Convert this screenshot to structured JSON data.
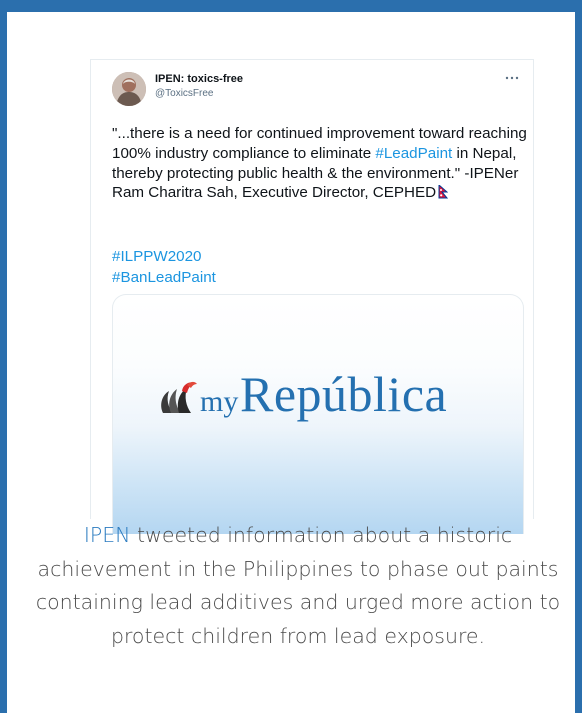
{
  "tweet": {
    "author_name": "IPEN: toxics-free",
    "author_handle": "@ToxicsFree",
    "text_before_hashtag": "\"...there is a need for continued improvement toward reaching 100% industry compliance to eliminate ",
    "inline_hashtag": "#LeadPaint",
    "text_after_hashtag": " in Nepal, thereby protecting public health & the environment.\" -IPENer Ram Charitra Sah, Executive Director, CEPHED",
    "hashtags": [
      "#ILPPW2020",
      "#BanLeadPaint"
    ],
    "link_preview": {
      "brand_prefix": "my",
      "brand_main": "República"
    }
  },
  "caption": {
    "link_text": "IPEN",
    "text": " tweeted information about a historic achievement in the Philippines to phase out paints containing lead additives and urged more action to protect children from lead exposure."
  },
  "colors": {
    "frame": "#2b6fad",
    "hashtag": "#1b95e0",
    "brand": "#2470b0",
    "caption_link": "#2b7bc0",
    "caption_text": "#4a4a4a"
  },
  "icons": [
    "more-icon",
    "nepal-flag-icon",
    "republica-logo-mark"
  ]
}
